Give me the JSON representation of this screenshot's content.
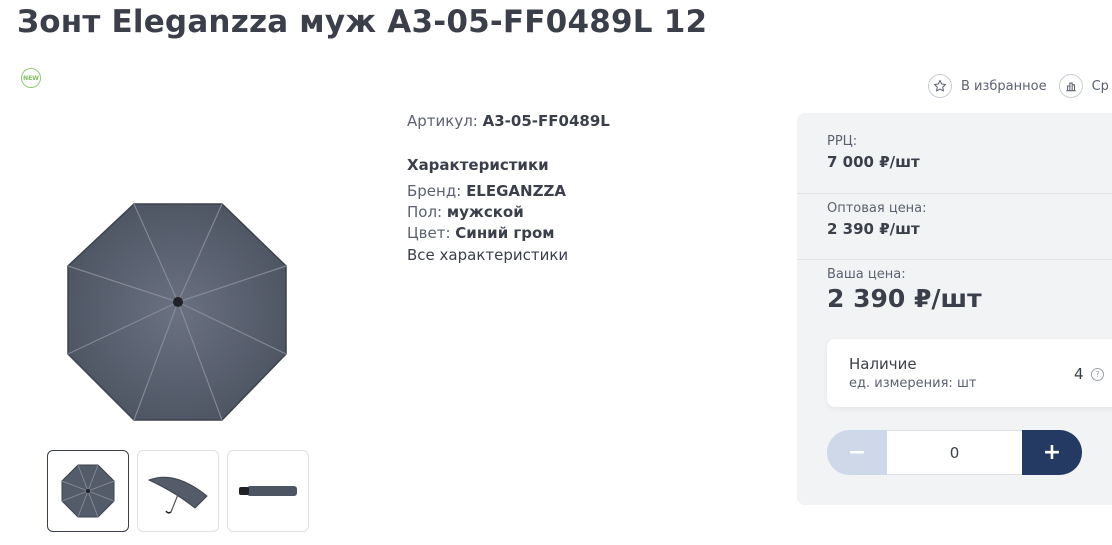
{
  "product": {
    "title": "Зонт Eleganzza муж A3-05-FF0489L 12",
    "badge": "NEW"
  },
  "actions": {
    "favorite_label": "В избранное",
    "compare_label": "Ср"
  },
  "specs": {
    "article_label": "Артикул:",
    "article_value": "A3-05-FF0489L",
    "heading": "Характеристики",
    "rows": [
      {
        "label": "Бренд:",
        "value": "ELEGANZZA"
      },
      {
        "label": "Пол:",
        "value": "мужской"
      },
      {
        "label": "Цвет:",
        "value": "Синий гром"
      }
    ],
    "all_link": "Все характеристики"
  },
  "prices": {
    "rrc_label": "РРЦ:",
    "rrc_value": "7 000 ₽/шт",
    "wholesale_label": "Оптовая цена:",
    "wholesale_value": "2 390 ₽/шт",
    "your_label": "Ваша цена:",
    "your_value": "2 390 ₽/шт"
  },
  "stock": {
    "title": "Наличие",
    "unit": "ед. измерения: шт",
    "quantity": "4",
    "help": "?"
  },
  "stepper": {
    "minus": "−",
    "value": "0",
    "plus": "+"
  },
  "colors": {
    "text": "#3a3f4a",
    "accent_dark": "#253a63",
    "accent_light": "#cfd8e8",
    "panel_bg": "#f2f3f5",
    "badge_green": "#7cbf60"
  }
}
